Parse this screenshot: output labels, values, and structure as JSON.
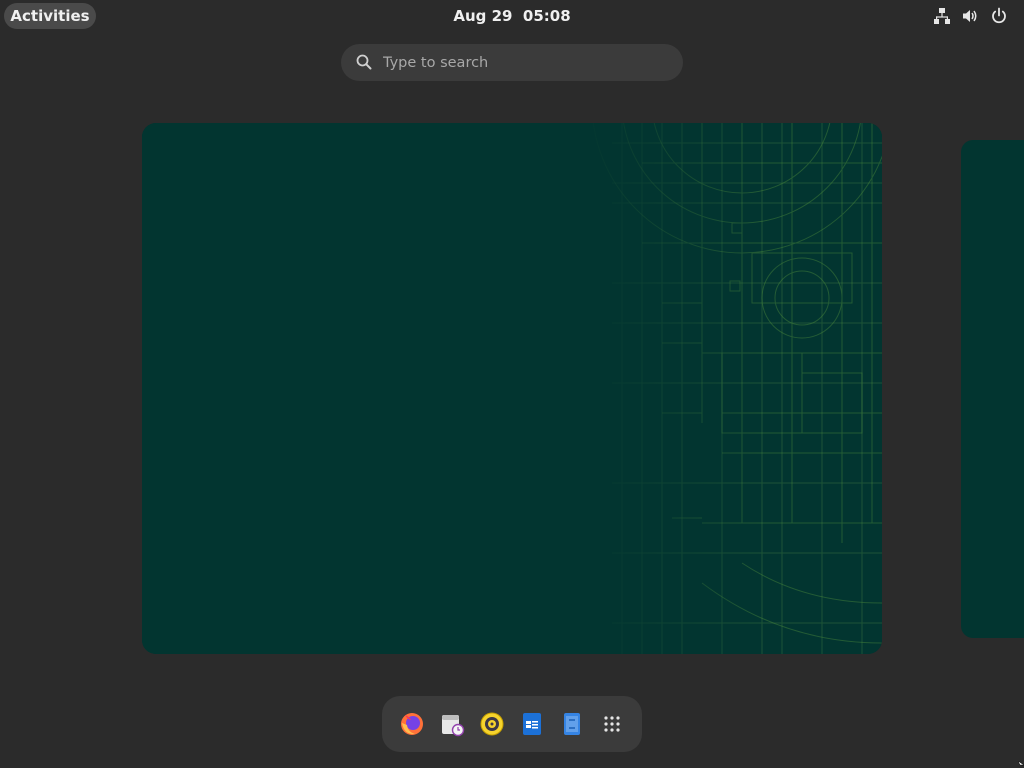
{
  "topbar": {
    "activities_label": "Activities",
    "clock_text": "Aug 29  05:08",
    "tray": {
      "network_icon": "network-wired-icon",
      "volume_icon": "volume-icon",
      "power_icon": "power-icon"
    }
  },
  "search": {
    "placeholder": "Type to search",
    "icon": "search-icon"
  },
  "workspaces": {
    "wallpaper_color": "#023530",
    "items": [
      "workspace-1",
      "workspace-2"
    ]
  },
  "dash": {
    "items": [
      {
        "name": "Firefox",
        "icon": "firefox-icon"
      },
      {
        "name": "Calendar",
        "icon": "calendar-icon"
      },
      {
        "name": "Rhythmbox",
        "icon": "rhythmbox-icon"
      },
      {
        "name": "Writer",
        "icon": "writer-icon"
      },
      {
        "name": "Software",
        "icon": "software-icon"
      },
      {
        "name": "Show Applications",
        "icon": "app-grid-icon"
      }
    ]
  },
  "colors": {
    "panel": "#2b2b2b",
    "pill": "#4a4a4a",
    "search_bg": "#3b3b3b",
    "wallpaper": "#023530",
    "blueprint_lines": "#3f7a3a"
  }
}
